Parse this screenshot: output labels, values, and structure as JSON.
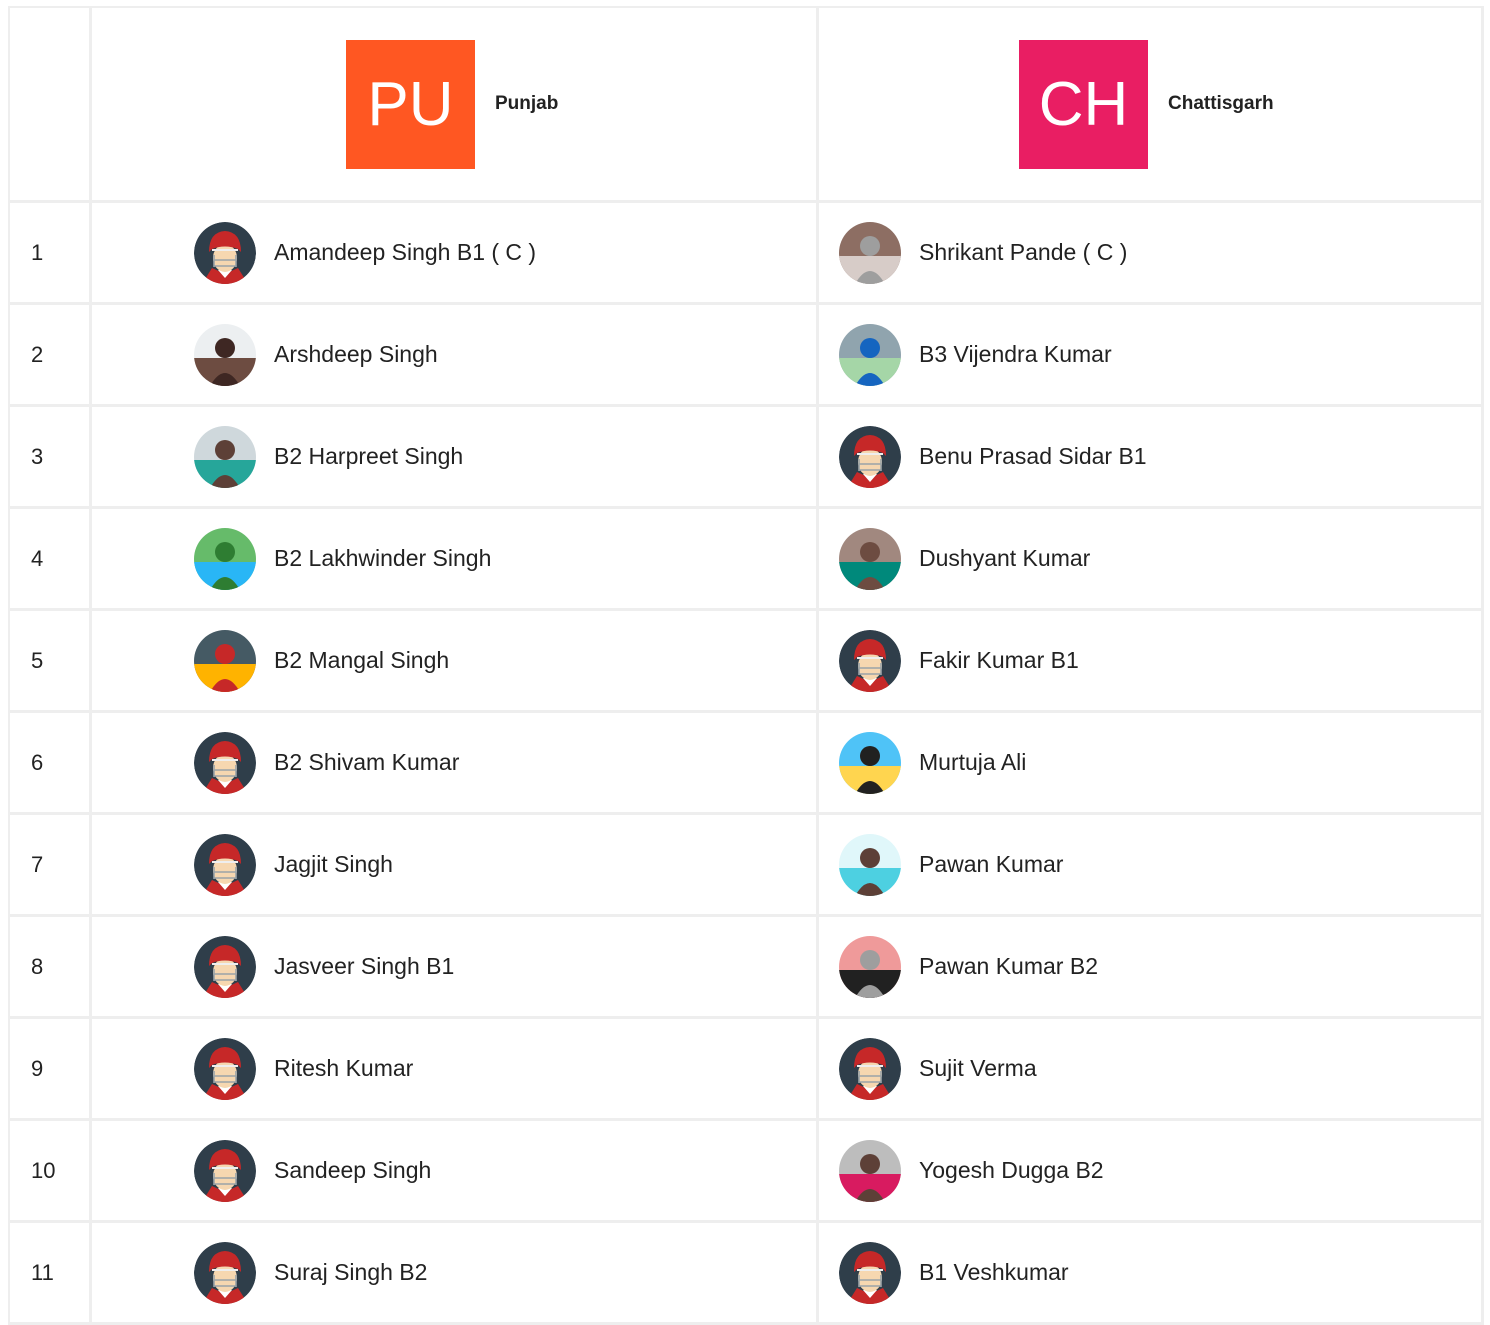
{
  "teams": [
    {
      "short": "PU",
      "name": "Punjab",
      "color": "#ff5722"
    },
    {
      "short": "CH",
      "name": "Chattisgarh",
      "color": "#e91e63"
    }
  ],
  "rows": [
    {
      "num": "1",
      "p1": {
        "name": "Amandeep Singh B1 ( C )",
        "avatar": "default-helmet-icon"
      },
      "p2": {
        "name": "Shrikant Pande ( C )",
        "avatar": "photo-outdoor"
      }
    },
    {
      "num": "2",
      "p1": {
        "name": "Arshdeep Singh",
        "avatar": "photo-face"
      },
      "p2": {
        "name": "B3 Vijendra Kumar",
        "avatar": "photo-field"
      }
    },
    {
      "num": "3",
      "p1": {
        "name": "B2 Harpreet Singh",
        "avatar": "photo-turban-teal"
      },
      "p2": {
        "name": "Benu Prasad Sidar B1",
        "avatar": "default-helmet-icon"
      }
    },
    {
      "num": "4",
      "p1": {
        "name": "B2 Lakhwinder Singh",
        "avatar": "photo-turban-green"
      },
      "p2": {
        "name": "Dushyant Kumar",
        "avatar": "photo-standing"
      }
    },
    {
      "num": "5",
      "p1": {
        "name": "B2 Mangal Singh",
        "avatar": "photo-collage"
      },
      "p2": {
        "name": "Fakir Kumar B1",
        "avatar": "default-helmet-icon"
      }
    },
    {
      "num": "6",
      "p1": {
        "name": "B2 Shivam Kumar",
        "avatar": "default-helmet-icon"
      },
      "p2": {
        "name": "Murtuja Ali",
        "avatar": "photo-trophies"
      }
    },
    {
      "num": "7",
      "p1": {
        "name": "Jagjit Singh",
        "avatar": "default-helmet-icon"
      },
      "p2": {
        "name": "Pawan Kumar",
        "avatar": "photo-sunglasses"
      }
    },
    {
      "num": "8",
      "p1": {
        "name": "Jasveer Singh B1",
        "avatar": "default-helmet-icon"
      },
      "p2": {
        "name": "Pawan Kumar B2",
        "avatar": "photo-cap"
      }
    },
    {
      "num": "9",
      "p1": {
        "name": "Ritesh Kumar",
        "avatar": "default-helmet-icon"
      },
      "p2": {
        "name": "Sujit Verma",
        "avatar": "default-helmet-icon"
      }
    },
    {
      "num": "10",
      "p1": {
        "name": "Sandeep Singh",
        "avatar": "default-helmet-icon"
      },
      "p2": {
        "name": "Yogesh Dugga B2",
        "avatar": "photo-bat"
      }
    },
    {
      "num": "11",
      "p1": {
        "name": "Suraj Singh B2",
        "avatar": "default-helmet-icon"
      },
      "p2": {
        "name": "B1 Veshkumar",
        "avatar": "default-helmet-icon"
      }
    }
  ]
}
